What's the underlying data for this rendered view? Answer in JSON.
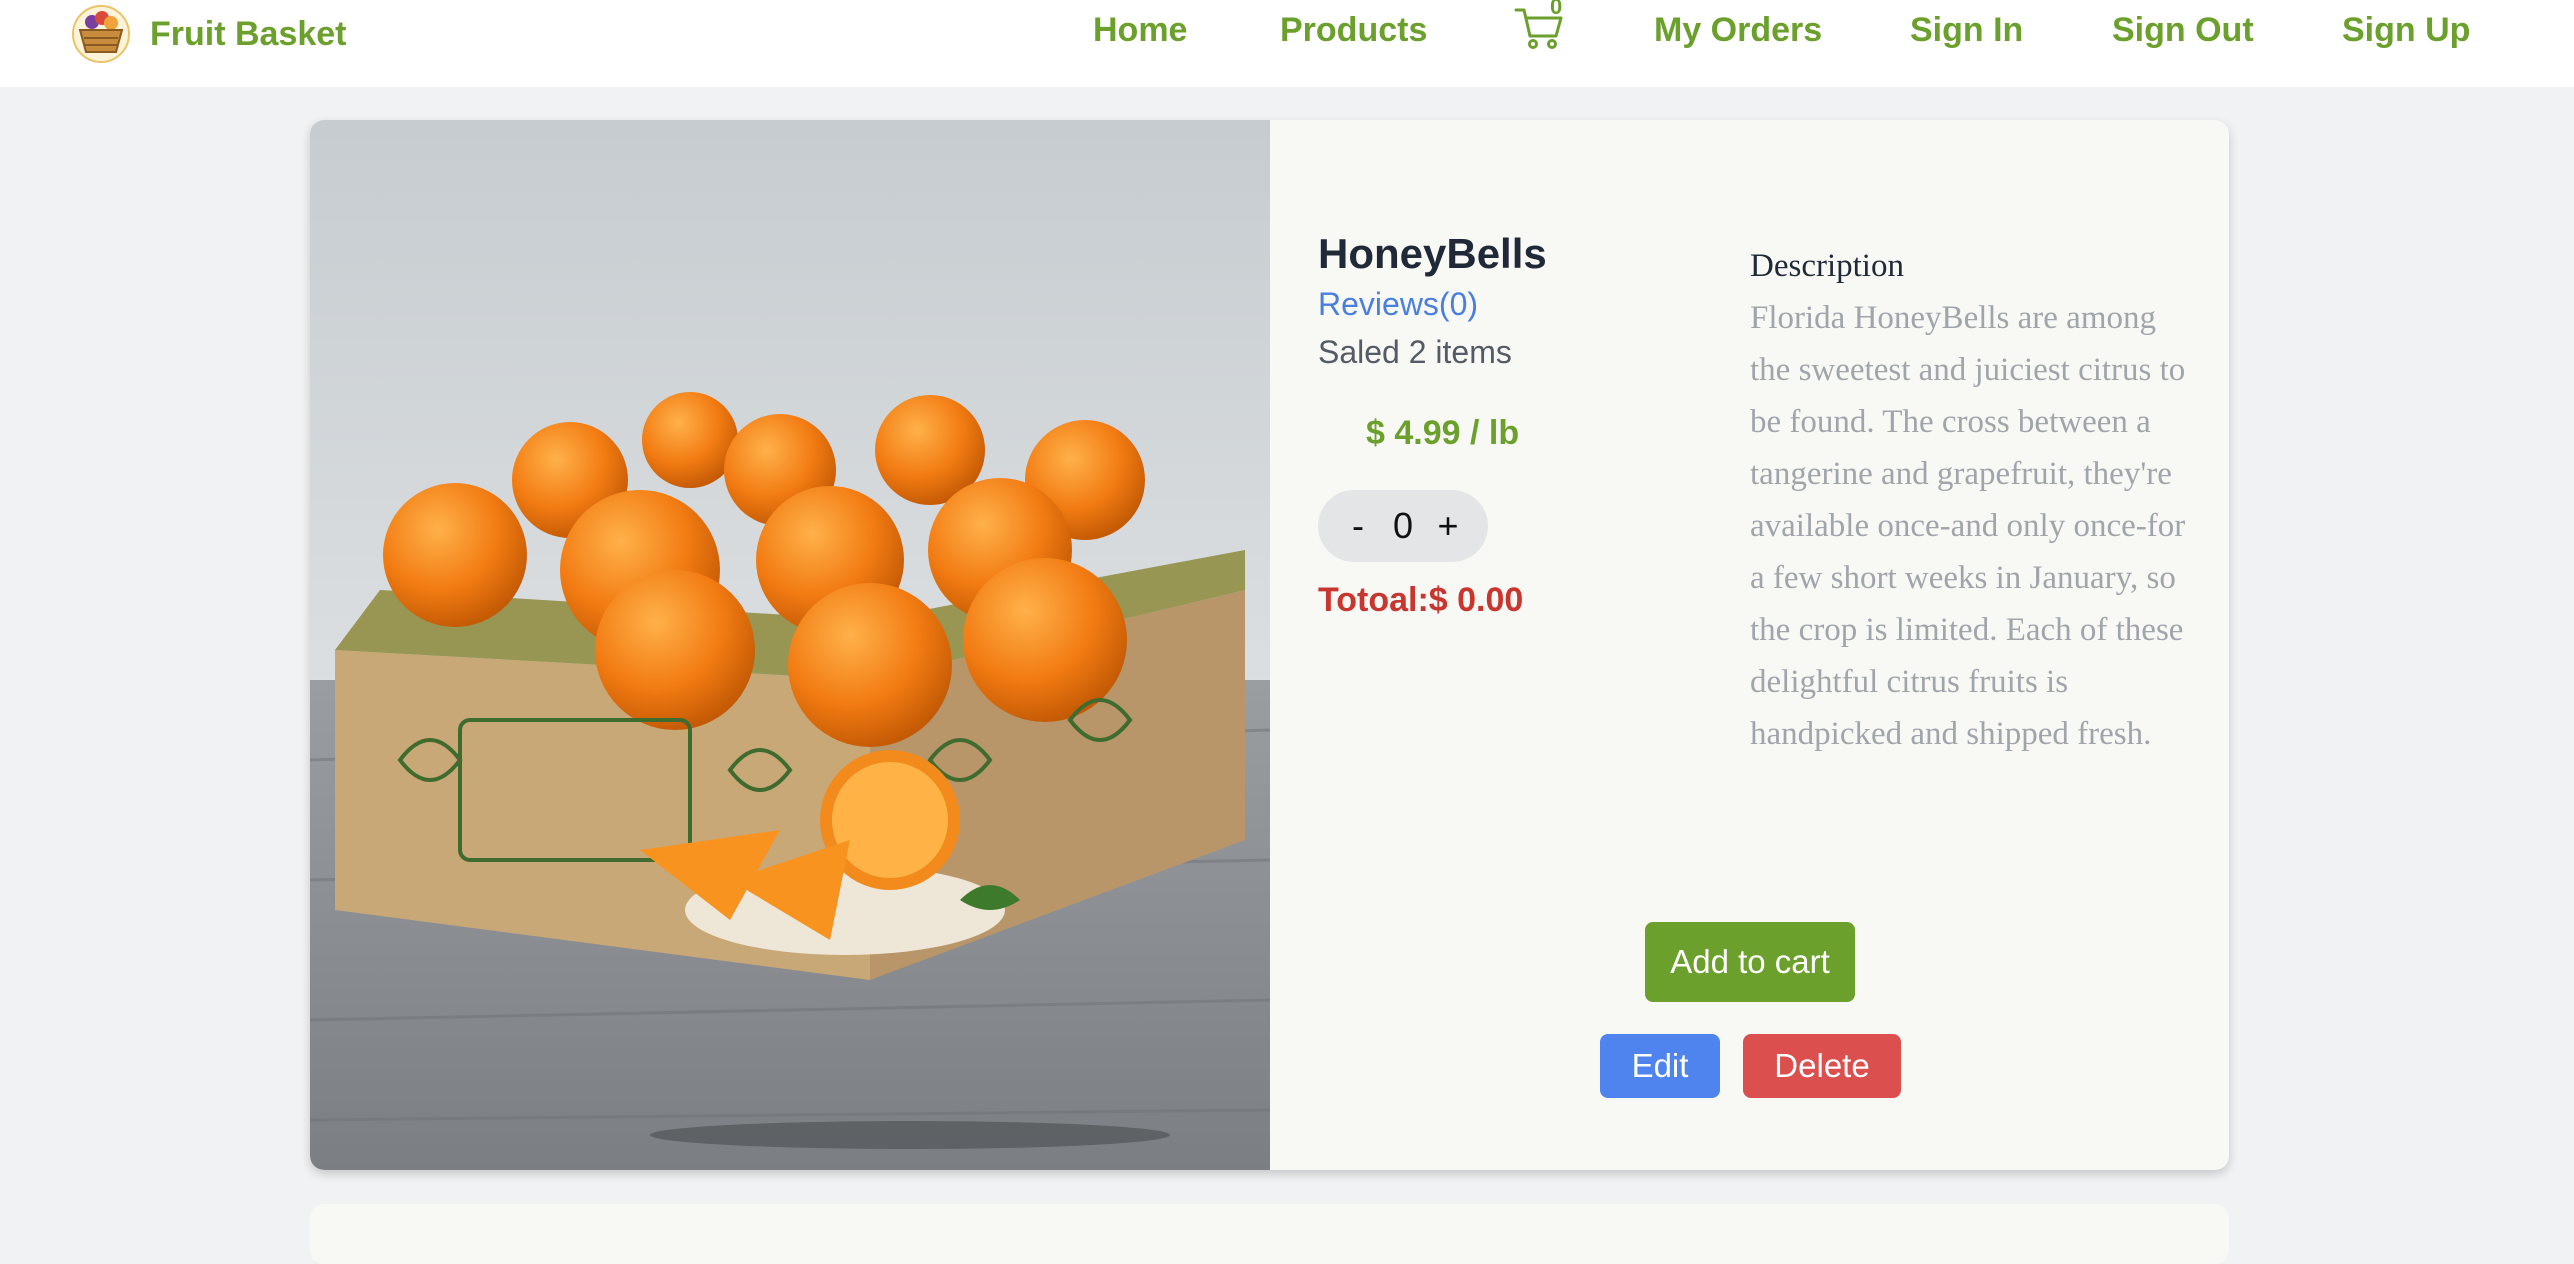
{
  "nav": {
    "brand": "Fruit Basket",
    "links": {
      "home": "Home",
      "products": "Products",
      "my_orders": "My Orders",
      "sign_in": "Sign In",
      "sign_out": "Sign Out",
      "sign_up": "Sign Up"
    },
    "cart_count": "0"
  },
  "product": {
    "name": "HoneyBells",
    "reviews": "Reviews(0)",
    "saled": "Saled 2 items",
    "price": "$ 4.99 / lb",
    "quantity": "0",
    "minus": "-",
    "plus": "+",
    "total": "Totoal:$ 0.00",
    "description_heading": "Description",
    "description": "Florida HoneyBells are among the sweetest and juiciest citrus to be found. The cross between a tangerine and grapefruit, they're available once-and only once-for a few short weeks in January, so the crop is limited. Each of these delightful citrus fruits is handpicked and shipped fresh.",
    "image_alt": "Box of HoneyBell oranges"
  },
  "actions": {
    "add_to_cart": "Add to cart",
    "edit": "Edit",
    "delete": "Delete"
  },
  "colors": {
    "brand_green": "#6aa02b",
    "edit_blue": "#4f83ee",
    "delete_red": "#dc4f4f",
    "total_red": "#c9352f",
    "link_blue": "#4a7fe0"
  },
  "icons": {
    "logo": "fruit-basket-logo-icon",
    "cart": "shopping-cart-icon"
  }
}
